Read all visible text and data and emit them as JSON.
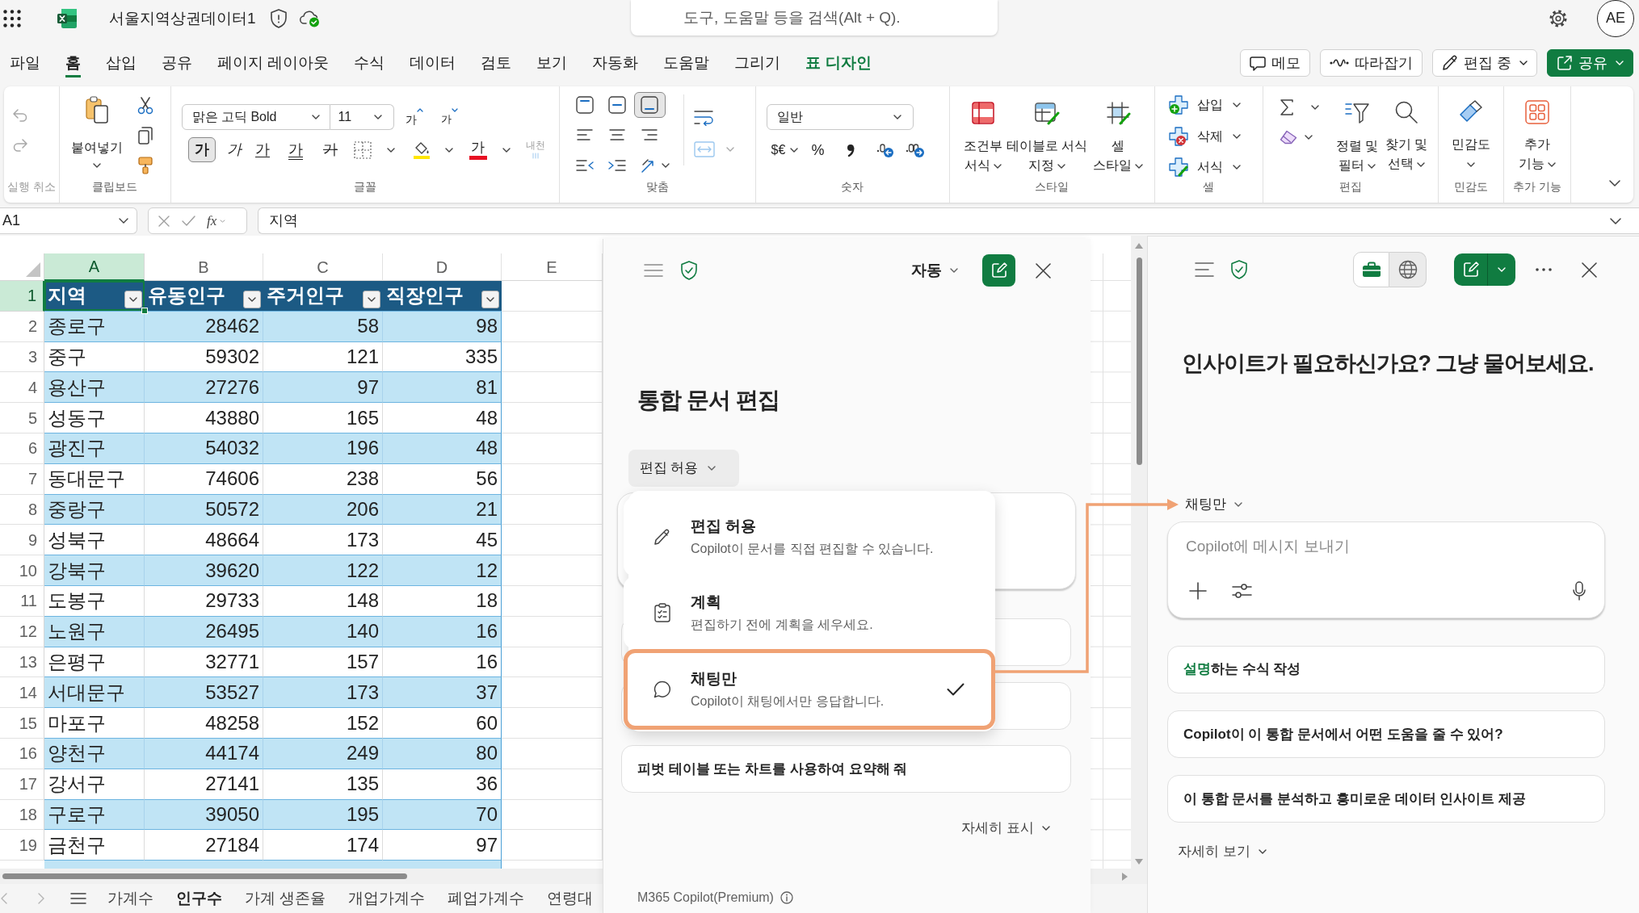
{
  "title_bar": {
    "title": "서울지역상권데이터1",
    "search": {
      "placeholder": "도구, 도움말 등을 검색(Alt + Q)."
    },
    "avatar": "AE"
  },
  "ribbon_tabs": [
    {
      "label": "파일",
      "selected": false,
      "kind": "normal"
    },
    {
      "label": "홈",
      "selected": true,
      "kind": "normal"
    },
    {
      "label": "삽입",
      "selected": false,
      "kind": "normal"
    },
    {
      "label": "공유",
      "selected": false,
      "kind": "normal"
    },
    {
      "label": "페이지 레이아웃",
      "selected": false,
      "kind": "normal"
    },
    {
      "label": "수식",
      "selected": false,
      "kind": "normal"
    },
    {
      "label": "데이터",
      "selected": false,
      "kind": "normal"
    },
    {
      "label": "검토",
      "selected": false,
      "kind": "normal"
    },
    {
      "label": "보기",
      "selected": false,
      "kind": "normal"
    },
    {
      "label": "자동화",
      "selected": false,
      "kind": "normal"
    },
    {
      "label": "도움말",
      "selected": false,
      "kind": "normal"
    },
    {
      "label": "그리기",
      "selected": false,
      "kind": "normal"
    },
    {
      "label": "표 디자인",
      "selected": false,
      "kind": "contextual"
    }
  ],
  "header_buttons": [
    {
      "label": "메모",
      "kind": "outline",
      "dropdown": false
    },
    {
      "label": "따라잡기",
      "kind": "outline",
      "dropdown": false
    },
    {
      "label": "편집 중",
      "kind": "outline",
      "dropdown": true
    },
    {
      "label": "공유",
      "kind": "primary",
      "dropdown": true
    }
  ],
  "ribbon": {
    "undo": {
      "label": "실행 취소",
      "disabled": true
    },
    "clipboard": {
      "label": "클립보드",
      "paste": "붙여넣기"
    },
    "font": {
      "label": "글꼴",
      "font_name": "맑은 고딕 Bold",
      "font_size": "11",
      "grow": "가",
      "shrink": "가",
      "styles": [
        {
          "glyph": "가",
          "kind": "bold",
          "selected": true
        },
        {
          "glyph": "가",
          "kind": "italic",
          "selected": false
        },
        {
          "glyph": "가",
          "kind": "underline",
          "selected": false
        },
        {
          "glyph": "가",
          "kind": "double_underline",
          "selected": false
        },
        {
          "glyph": "가",
          "kind": "strikethrough",
          "selected": false
        }
      ],
      "font_color": "가",
      "phonetic": {
        "label": "내천",
        "disabled": true
      }
    },
    "alignment": {
      "label": "맞춤",
      "vertical": [
        {
          "selected": false
        },
        {
          "selected": false
        },
        {
          "selected": true
        }
      ],
      "merge": {
        "disabled": true
      }
    },
    "number": {
      "label": "숫자",
      "format": "일반",
      "currency": "$€",
      "percent": "%"
    },
    "styles": {
      "label": "스타일",
      "buttons": [
        {
          "lines": [
            "조건부",
            "서식"
          ]
        },
        {
          "lines": [
            "테이블로 서식",
            "지정"
          ]
        },
        {
          "lines": [
            "셀",
            "스타일"
          ]
        }
      ]
    },
    "cells": {
      "label": "셀",
      "buttons": [
        "삽입",
        "삭제",
        "서식"
      ]
    },
    "editing": {
      "label": "편집",
      "buttons": [
        {
          "lines": [
            "정렬 및",
            "필터"
          ]
        },
        {
          "lines": [
            "찾기 및",
            "선택"
          ]
        }
      ]
    },
    "sensitivity": {
      "label": "민감도",
      "button": {
        "lines": [
          "민감도"
        ]
      }
    },
    "add_ins": {
      "label": "추가 기능",
      "button": {
        "lines": [
          "추가",
          "기능"
        ]
      }
    }
  },
  "formula_bar": {
    "name_box": "A1",
    "function_label": "fx",
    "formula": "지역"
  },
  "sheet": {
    "columns": [
      {
        "label": "A",
        "selected": true
      },
      {
        "label": "B",
        "selected": false
      },
      {
        "label": "C",
        "selected": false
      },
      {
        "label": "D",
        "selected": false
      },
      {
        "label": "E",
        "selected": false
      }
    ],
    "table": {
      "header": {
        "row": "1",
        "selected": true,
        "cells": [
          "지역",
          "유동인구",
          "주거인구",
          "직장인구"
        ]
      },
      "rows": [
        {
          "row": "2",
          "selected": false,
          "cells": [
            "종로구",
            "28462",
            "58",
            "98"
          ]
        },
        {
          "row": "3",
          "selected": false,
          "cells": [
            "중구",
            "59302",
            "121",
            "335"
          ]
        },
        {
          "row": "4",
          "selected": false,
          "cells": [
            "용산구",
            "27276",
            "97",
            "81"
          ]
        },
        {
          "row": "5",
          "selected": false,
          "cells": [
            "성동구",
            "43880",
            "165",
            "48"
          ]
        },
        {
          "row": "6",
          "selected": false,
          "cells": [
            "광진구",
            "54032",
            "196",
            "48"
          ]
        },
        {
          "row": "7",
          "selected": false,
          "cells": [
            "동대문구",
            "74606",
            "238",
            "56"
          ]
        },
        {
          "row": "8",
          "selected": false,
          "cells": [
            "중랑구",
            "50572",
            "206",
            "21"
          ]
        },
        {
          "row": "9",
          "selected": false,
          "cells": [
            "성북구",
            "48664",
            "173",
            "45"
          ]
        },
        {
          "row": "10",
          "selected": false,
          "cells": [
            "강북구",
            "39620",
            "122",
            "12"
          ]
        },
        {
          "row": "11",
          "selected": false,
          "cells": [
            "도봉구",
            "29733",
            "148",
            "18"
          ]
        },
        {
          "row": "12",
          "selected": false,
          "cells": [
            "노원구",
            "26495",
            "140",
            "16"
          ]
        },
        {
          "row": "13",
          "selected": false,
          "cells": [
            "은평구",
            "32771",
            "157",
            "16"
          ]
        },
        {
          "row": "14",
          "selected": false,
          "cells": [
            "서대문구",
            "53527",
            "173",
            "37"
          ]
        },
        {
          "row": "15",
          "selected": false,
          "cells": [
            "마포구",
            "48258",
            "152",
            "60"
          ]
        },
        {
          "row": "16",
          "selected": false,
          "cells": [
            "양천구",
            "44174",
            "249",
            "80"
          ]
        },
        {
          "row": "17",
          "selected": false,
          "cells": [
            "강서구",
            "27141",
            "135",
            "36"
          ]
        },
        {
          "row": "18",
          "selected": false,
          "cells": [
            "구로구",
            "39050",
            "195",
            "70"
          ]
        },
        {
          "row": "19",
          "selected": false,
          "cells": [
            "금천구",
            "27184",
            "174",
            "97"
          ]
        }
      ]
    },
    "tabs": [
      {
        "label": "가계수",
        "selected": false
      },
      {
        "label": "인구수",
        "selected": true
      },
      {
        "label": "가계 생존율",
        "selected": false
      },
      {
        "label": "개업가계수",
        "selected": false
      },
      {
        "label": "폐업가계수",
        "selected": false
      },
      {
        "label": "연령대",
        "selected": false
      }
    ]
  },
  "copilot_edit_pane": {
    "mode": "자동",
    "heading": "통합 문서 편집",
    "mode_button": "편집 허용",
    "mode_menu": [
      {
        "title": "편집 허용",
        "description": "Copilot이 문서를 직접 편집할 수 있습니다.",
        "selected": false
      },
      {
        "title": "계획",
        "description": "편집하기 전에 계획을 세우세요.",
        "selected": false
      },
      {
        "title": "채팅만",
        "description": "Copilot이 채팅에서만 응답합니다.",
        "selected": true
      }
    ],
    "suggestions": [
      "피벗 테이블 또는 차트를 사용하여 요약해 줘"
    ],
    "more": "자세히 표시",
    "footer": "M365 Copilot(Premium)"
  },
  "copilot_chat_pane": {
    "scope": [
      {
        "selected": true
      },
      {
        "selected": false
      }
    ],
    "heading": "인사이트가 필요하신가요? 그냥 물어보세요.",
    "mode_button": "채팅만",
    "input": {
      "placeholder": "Copilot에 메시지 보내기"
    },
    "suggestions": [
      "**설명**하는 수식 작성",
      "Copilot이 이 통합 문서에서 어떤 도움을 줄 수 있어?",
      "이 통합 문서를 분석하고 흥미로운 데이터 인사이트 제공"
    ],
    "more": "자세히 보기"
  }
}
